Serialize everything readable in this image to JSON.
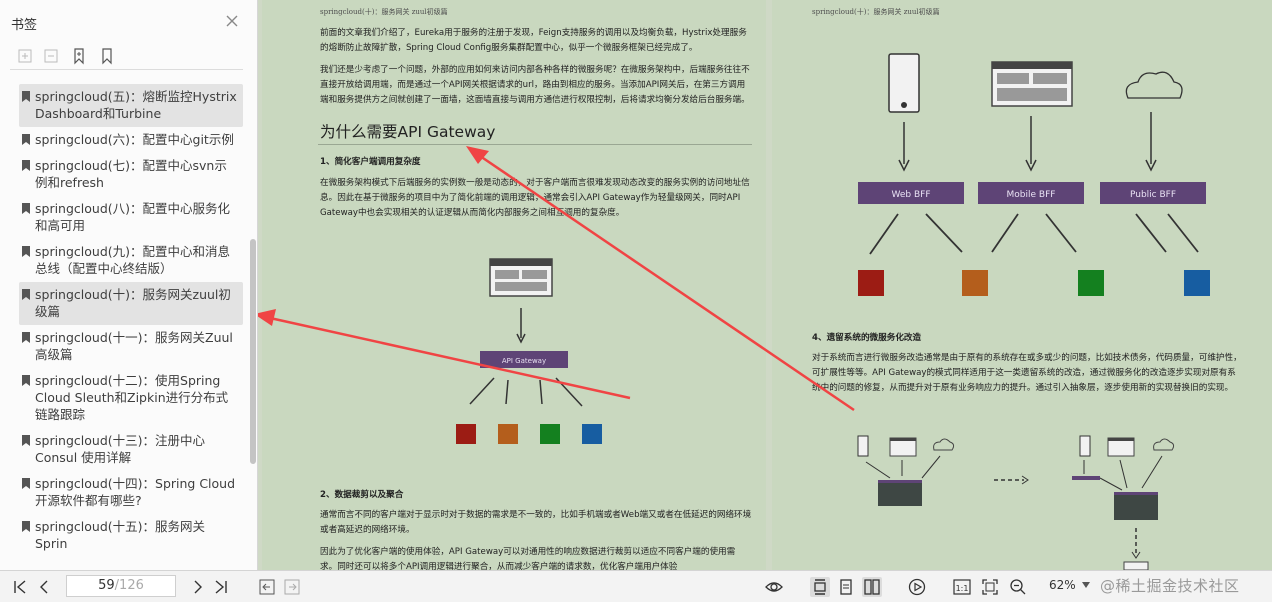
{
  "sidebar": {
    "title": "书签",
    "items": [
      {
        "label": "springcloud(五)：熔断监控Hystrix Dashboard和Turbine",
        "selected": true
      },
      {
        "label": "springcloud(六)：配置中心git示例",
        "selected": false
      },
      {
        "label": "springcloud(七)：配置中心svn示例和refresh",
        "selected": false
      },
      {
        "label": "springcloud(八)：配置中心服务化和高可用",
        "selected": false
      },
      {
        "label": "springcloud(九)：配置中心和消息总线（配置中心终结版）",
        "selected": false
      },
      {
        "label": "springcloud(十)：服务网关zuul初级篇",
        "selected": true
      },
      {
        "label": "springcloud(十一)：服务网关Zuul高级篇",
        "selected": false
      },
      {
        "label": "springcloud(十二)：使用Spring Cloud Sleuth和Zipkin进行分布式链路跟踪",
        "selected": false
      },
      {
        "label": "springcloud(十三)：注册中心 Consul 使用详解",
        "selected": false
      },
      {
        "label": "springcloud(十四)：Spring Cloud 开源软件都有哪些?",
        "selected": false
      },
      {
        "label": "springcloud(十五)：服务网关 Sprin",
        "selected": false
      }
    ]
  },
  "page1": {
    "header": "springcloud(十)：服务网关 zuul初级篇",
    "para1": "前面的文章我们介绍了，Eureka用于服务的注册于发现，Feign支持服务的调用以及均衡负载，Hystrix处理服务的熔断防止故障扩散，Spring Cloud Config服务集群配置中心，似乎一个微服务框架已经完成了。",
    "para2": "我们还是少考虑了一个问题，外部的应用如何来访问内部各种各样的微服务呢？在微服务架构中，后端服务往往不直接开放给调用端，而是通过一个API网关根据请求的url，路由到相应的服务。当添加API网关后，在第三方调用端和服务提供方之间就创建了一面墙，这面墙直接与调用方通信进行权限控制，后将请求均衡分发给后台服务端。",
    "heading": "为什么需要API Gateway",
    "sub1": "1、简化客户端调用复杂度",
    "para3": "在微服务架构模式下后端服务的实例数一般是动态的，对于客户端而言很难发现动态改变的服务实例的访问地址信息。因此在基于微服务的项目中为了简化前端的调用逻辑，通常会引入API Gateway作为轻量级网关，同时API Gateway中也会实现相关的认证逻辑从而简化内部服务之间相互调用的复杂度。",
    "gateway_label": "API Gateway",
    "sub2": "2、数据裁剪以及聚合",
    "para4": "通常而言不同的客户端对于显示时对于数据的需求是不一致的，比如手机端或者Web端又或者在低延迟的网络环境或者高延迟的网络环境。",
    "para5": "因此为了优化客户端的使用体验，API Gateway可以对通用性的响应数据进行裁剪以适应不同客户端的使用需求。同时还可以将多个API调用逻辑进行聚合，从而减少客户端的请求数，优化客户端用户体验"
  },
  "page2": {
    "header": "springcloud(十)：服务网关 zuul初级篇",
    "bff_labels": [
      "Web BFF",
      "Mobile BFF",
      "Public BFF"
    ],
    "sub": "4、遗留系统的微服务化改造",
    "para": "对于系统而言进行微服务改造通常是由于原有的系统存在或多或少的问题，比如技术债务，代码质量，可维护性，可扩展性等等。API Gateway的模式同样适用于这一类遗留系统的改造，通过微服务化的改造逐步实现对原有系统中的问题的修复，从而提升对于原有业务响应力的提升。通过引入抽象层，逐步使用新的实现替换旧的实现。"
  },
  "toolbar": {
    "current_page": "59",
    "total_pages": "/126",
    "zoom": "62%",
    "watermark": "@稀土掘金技术社区"
  },
  "colors": {
    "red": "#9c1c14",
    "orange": "#b45e1c",
    "green": "#14801f",
    "blue": "#175da1",
    "purple": "#5e4476",
    "arrow": "#f04444"
  }
}
